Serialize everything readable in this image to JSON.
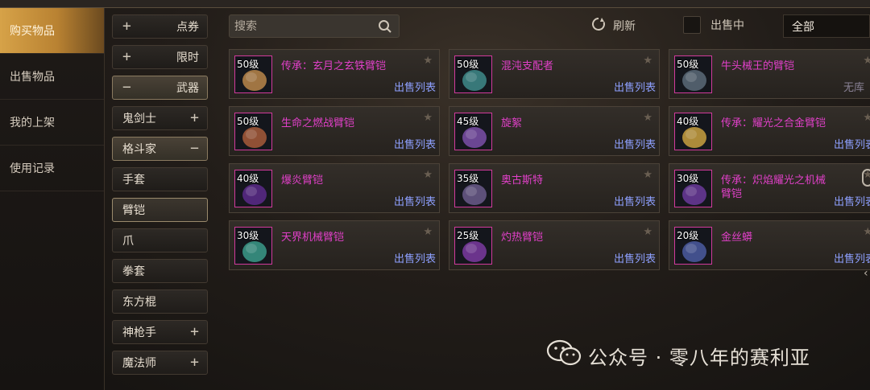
{
  "nav": {
    "items": [
      {
        "label": "购买物品"
      },
      {
        "label": "出售物品"
      },
      {
        "label": "我的上架"
      },
      {
        "label": "使用记录"
      }
    ]
  },
  "categories": {
    "items": [
      {
        "label": "点券",
        "sign": "+"
      },
      {
        "label": "限时",
        "sign": "+"
      },
      {
        "label": "武器",
        "sign": "−"
      },
      {
        "label": "鬼剑士",
        "sign": "+"
      },
      {
        "label": "格斗家",
        "sign": "−"
      },
      {
        "label": "手套"
      },
      {
        "label": "臂铠"
      },
      {
        "label": "爪"
      },
      {
        "label": "拳套"
      },
      {
        "label": "东方棍"
      },
      {
        "label": "神枪手",
        "sign": "+"
      },
      {
        "label": "魔法师",
        "sign": "+"
      }
    ]
  },
  "toolbar": {
    "search_placeholder": "搜索",
    "refresh_label": "刷新",
    "onsale_label": "出售中",
    "filter_value": "全部"
  },
  "items": [
    {
      "level": "50级",
      "name": "传承：玄月之玄铁臂铠",
      "sale": "出售列表",
      "hue": "#b8864a"
    },
    {
      "level": "50级",
      "name": "混沌支配者",
      "sale": "出售列表",
      "hue": "#3e8a8a"
    },
    {
      "level": "50级",
      "name": "牛头械王的臂铠",
      "sale": "",
      "extra": "无库",
      "hue": "#5a6a78"
    },
    {
      "level": "50级",
      "name": "生命之燃战臂铠",
      "sale": "出售列表",
      "hue": "#a65a3a"
    },
    {
      "level": "45级",
      "name": "旋絮",
      "sale": "出售列表",
      "hue": "#7a4fa8"
    },
    {
      "level": "40级",
      "name": "传承：耀光之合金臂铠",
      "sale": "出售列表",
      "hue": "#c8a040"
    },
    {
      "level": "40级",
      "name": "爆炎臂铠",
      "sale": "出售列表",
      "hue": "#5a2a8a"
    },
    {
      "level": "35级",
      "name": "奥古斯特",
      "sale": "出售列表",
      "hue": "#6a5a8a"
    },
    {
      "level": "30级",
      "name": "传承：炽焰耀光之机械臂铠",
      "sale": "出售列表",
      "hue": "#6a3a9a"
    },
    {
      "level": "30级",
      "name": "天界机械臂铠",
      "sale": "出售列表",
      "hue": "#3a9a8a"
    },
    {
      "level": "25级",
      "name": "灼热臂铠",
      "sale": "出售列表",
      "hue": "#7a3aa0"
    },
    {
      "level": "20级",
      "name": "金丝蟒",
      "sale": "出售列表",
      "hue": "#4a5aa0"
    }
  ],
  "watermark": {
    "text": "公众号 · 零八年的赛利亚"
  },
  "colors": {
    "accent": "#d6a248",
    "item_name": "#e040c8",
    "sale_link": "#8ea0ff",
    "thumb_border": "#d13a9c"
  }
}
